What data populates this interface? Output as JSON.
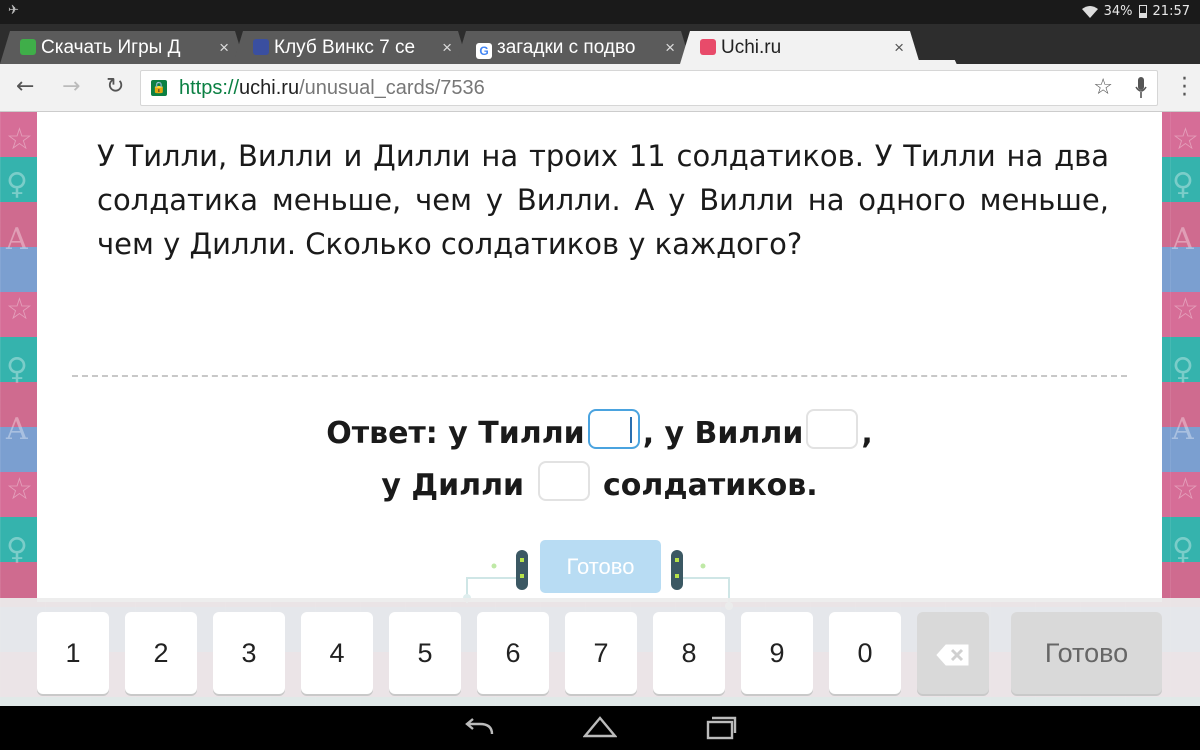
{
  "status_bar": {
    "battery": "34%",
    "time": "21:57"
  },
  "tabs": [
    {
      "title": "Скачать Игры Д",
      "close": "×",
      "favicon_color": "#3fae49"
    },
    {
      "title": "Клуб Винкс 7 се",
      "close": "×",
      "favicon_color": "#3a4fa0"
    },
    {
      "title": "загадки с подво",
      "close": "×",
      "favicon_color": "#4285f4"
    },
    {
      "title": "Uchi.ru",
      "close": "×",
      "favicon_color": "#e84b6a"
    }
  ],
  "toolbar": {
    "url_scheme": "https://",
    "url_host": "uchi.ru",
    "url_path": "/unusual_cards/7536"
  },
  "task": {
    "text": "У Тилли, Вилли и Дилли на троих 11 солдатиков. У Тилли на два солдатика меньше, чем у Вилли. А у Вилли на одного меньше, чем у Дилли. Сколько солдатиков у каждого?"
  },
  "answer": {
    "part1": "Ответ: у Тилли",
    "part2": ", у Вилли",
    "part3": ",",
    "part4": "у Дилли",
    "part5": "солдатиков.",
    "input_tilli": "",
    "input_villi": "",
    "input_dilli": ""
  },
  "ready_button": {
    "label": "Готово"
  },
  "keyboard": {
    "keys": [
      "1",
      "2",
      "3",
      "4",
      "5",
      "6",
      "7",
      "8",
      "9",
      "0"
    ],
    "done_label": "Готово"
  },
  "colors": {
    "accent": "#4aa3df",
    "ready_button": "#b8dcf3",
    "secure": "#0b8043"
  }
}
